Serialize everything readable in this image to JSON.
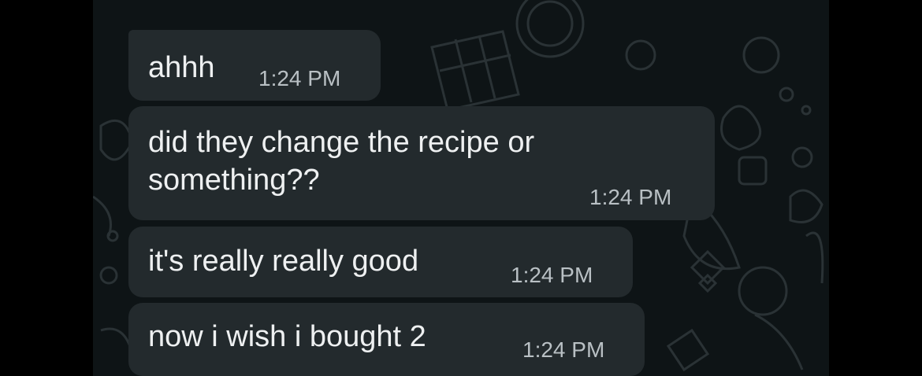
{
  "theme": {
    "background": "#0e1416",
    "bubble_color": "#232a2d",
    "text_color": "#eef0f1",
    "time_color": "#b9c0c4"
  },
  "messages": [
    {
      "text": "ahhh",
      "time": "1:24 PM"
    },
    {
      "text": "did they change the recipe or something??",
      "time": "1:24 PM"
    },
    {
      "text": "it's really really good",
      "time": "1:24 PM"
    },
    {
      "text": "now i wish i bought 2",
      "time": "1:24 PM"
    }
  ]
}
